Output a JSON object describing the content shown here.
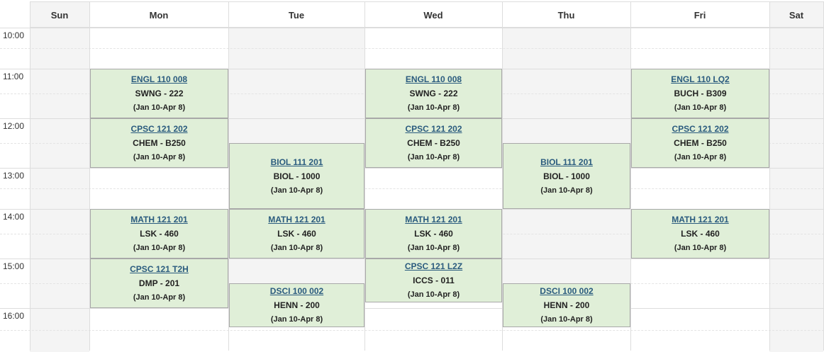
{
  "days": [
    "Sun",
    "Mon",
    "Tue",
    "Wed",
    "Thu",
    "Fri",
    "Sat"
  ],
  "times": [
    "10:00",
    "11:00",
    "12:00",
    "13:00",
    "14:00",
    "15:00",
    "16:00"
  ],
  "colors": {
    "event_bg": "#e0efd8",
    "event_border": "#a8a8a8",
    "link": "#2a5b7e",
    "shade": "#f4f4f4"
  },
  "events": [
    {
      "day": 1,
      "start": "11:00",
      "end": "12:00",
      "code": "ENGL 110 008",
      "room": "SWNG - 222",
      "dates": "(Jan 10-Apr 8)"
    },
    {
      "day": 3,
      "start": "11:00",
      "end": "12:00",
      "code": "ENGL 110 008",
      "room": "SWNG - 222",
      "dates": "(Jan 10-Apr 8)"
    },
    {
      "day": 5,
      "start": "11:00",
      "end": "12:00",
      "code": "ENGL 110 LQ2",
      "room": "BUCH - B309",
      "dates": "(Jan 10-Apr 8)"
    },
    {
      "day": 1,
      "start": "12:00",
      "end": "13:00",
      "code": "CPSC 121 202",
      "room": "CHEM - B250",
      "dates": "(Jan 10-Apr 8)"
    },
    {
      "day": 3,
      "start": "12:00",
      "end": "13:00",
      "code": "CPSC 121 202",
      "room": "CHEM - B250",
      "dates": "(Jan 10-Apr 8)"
    },
    {
      "day": 5,
      "start": "12:00",
      "end": "13:00",
      "code": "CPSC 121 202",
      "room": "CHEM - B250",
      "dates": "(Jan 10-Apr 8)"
    },
    {
      "day": 2,
      "start": "12:30",
      "end": "14:00",
      "code": "BIOL 111 201",
      "room": "BIOL - 1000",
      "dates": "(Jan 10-Apr 8)"
    },
    {
      "day": 4,
      "start": "12:30",
      "end": "14:00",
      "code": "BIOL 111 201",
      "room": "BIOL - 1000",
      "dates": "(Jan 10-Apr 8)"
    },
    {
      "day": 1,
      "start": "14:00",
      "end": "15:00",
      "code": "MATH 121 201",
      "room": "LSK - 460",
      "dates": "(Jan 10-Apr 8)"
    },
    {
      "day": 2,
      "start": "14:00",
      "end": "15:00",
      "code": "MATH 121 201",
      "room": "LSK - 460",
      "dates": "(Jan 10-Apr 8)"
    },
    {
      "day": 3,
      "start": "14:00",
      "end": "15:00",
      "code": "MATH 121 201",
      "room": "LSK - 460",
      "dates": "(Jan 10-Apr 8)"
    },
    {
      "day": 5,
      "start": "14:00",
      "end": "15:00",
      "code": "MATH 121 201",
      "room": "LSK - 460",
      "dates": "(Jan 10-Apr 8)"
    },
    {
      "day": 1,
      "start": "15:00",
      "end": "16:00",
      "code": "CPSC 121 T2H",
      "room": "DMP - 201",
      "dates": "(Jan 10-Apr 8)"
    },
    {
      "day": 3,
      "start": "15:00",
      "end": "17:00",
      "code": "CPSC 121 L2Z",
      "room": "ICCS - 011",
      "dates": "(Jan 10-Apr 8)"
    },
    {
      "day": 2,
      "start": "15:30",
      "end": "17:00",
      "code": "DSCI 100 002",
      "room": "HENN - 200",
      "dates": "(Jan 10-Apr 8)"
    },
    {
      "day": 4,
      "start": "15:30",
      "end": "17:00",
      "code": "DSCI 100 002",
      "room": "HENN - 200",
      "dates": "(Jan 10-Apr 8)"
    }
  ]
}
